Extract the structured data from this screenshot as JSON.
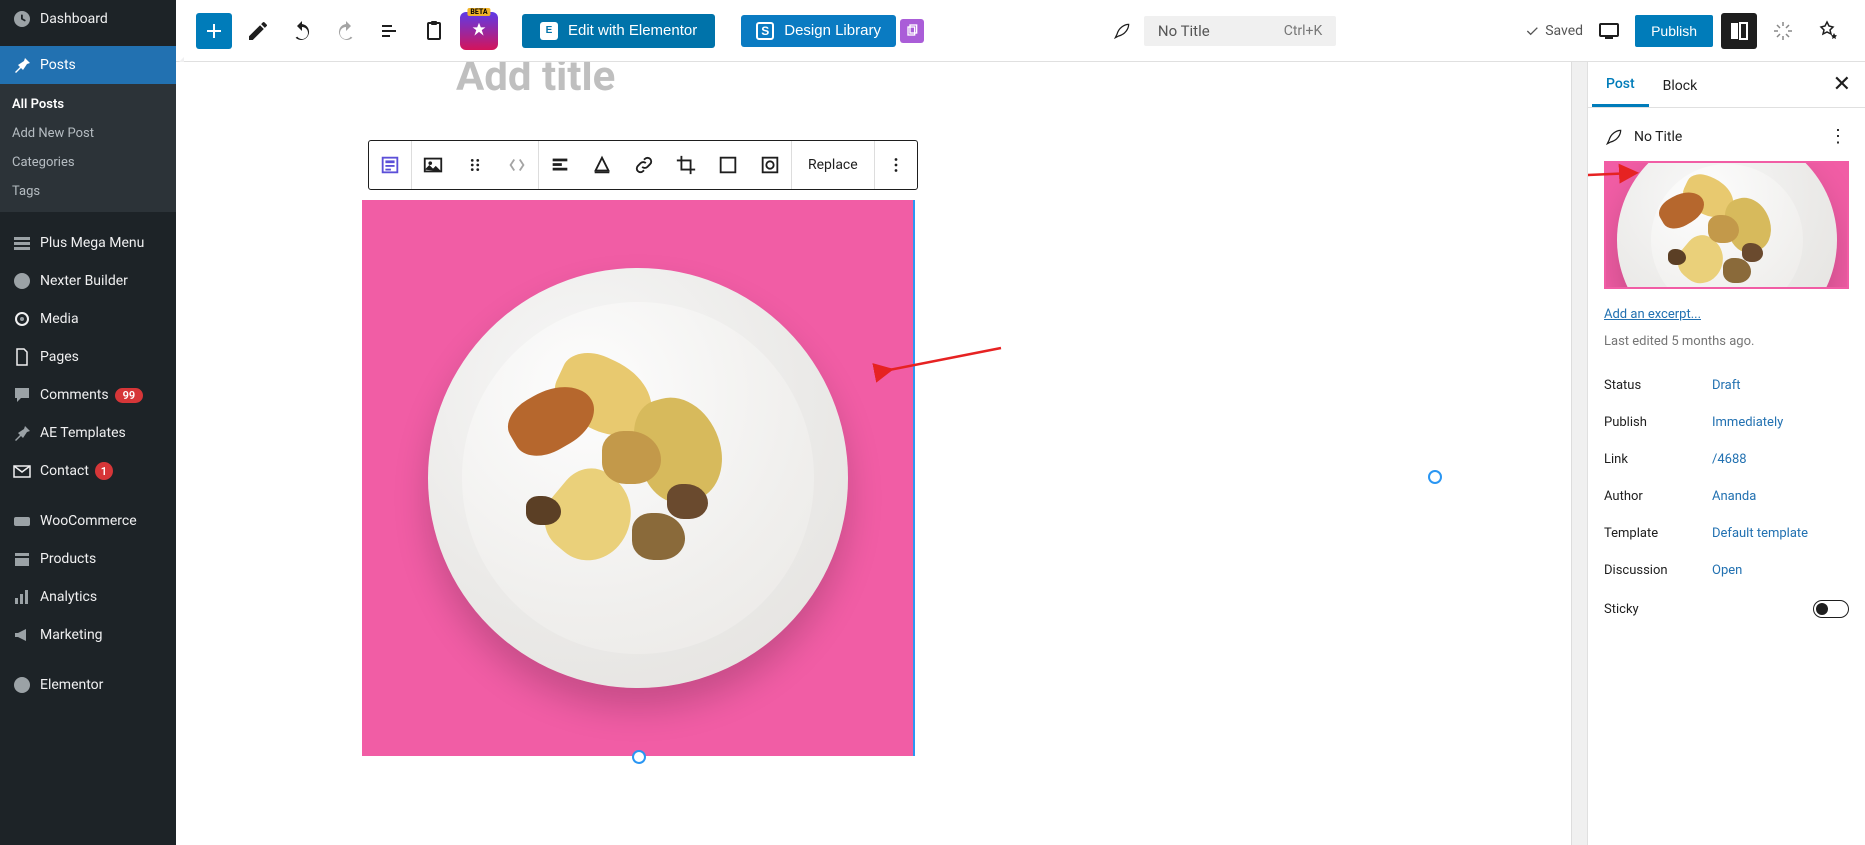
{
  "sidebar": {
    "dashboard": "Dashboard",
    "posts": "Posts",
    "submenu": {
      "all_posts": "All Posts",
      "add_new": "Add New Post",
      "categories": "Categories",
      "tags": "Tags"
    },
    "plus_mega_menu": "Plus Mega Menu",
    "nexter_builder": "Nexter Builder",
    "media": "Media",
    "pages": "Pages",
    "comments": "Comments",
    "comments_badge": "99",
    "ae_templates": "AE Templates",
    "contact": "Contact",
    "contact_badge": "1",
    "woocommerce": "WooCommerce",
    "products": "Products",
    "analytics": "Analytics",
    "marketing": "Marketing",
    "elementor": "Elementor"
  },
  "topbar": {
    "edit_elementor": "Edit with Elementor",
    "design_library": "Design Library",
    "title": "No Title",
    "shortcut": "Ctrl+K",
    "saved": "Saved",
    "publish": "Publish"
  },
  "block_toolbar": {
    "replace": "Replace"
  },
  "editor": {
    "title_placeholder": "Add title"
  },
  "settings": {
    "tabs": {
      "post": "Post",
      "block": "Block"
    },
    "post_title": "No Title",
    "add_excerpt": "Add an excerpt...",
    "last_edited": "Last edited 5 months ago.",
    "rows": {
      "status": {
        "label": "Status",
        "value": "Draft"
      },
      "publish": {
        "label": "Publish",
        "value": "Immediately"
      },
      "link": {
        "label": "Link",
        "value": "/4688"
      },
      "author": {
        "label": "Author",
        "value": "Ananda"
      },
      "template": {
        "label": "Template",
        "value": "Default template"
      },
      "discussion": {
        "label": "Discussion",
        "value": "Open"
      },
      "sticky": {
        "label": "Sticky"
      }
    }
  }
}
